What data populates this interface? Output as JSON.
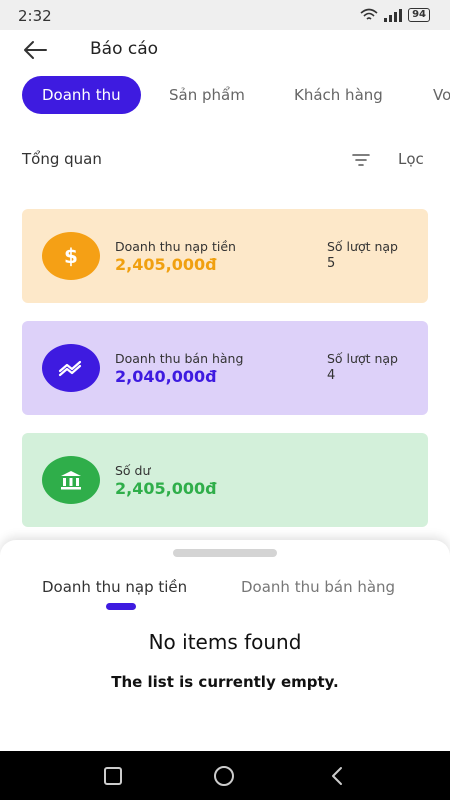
{
  "status": {
    "time": "2:32",
    "battery": "94"
  },
  "header": {
    "title": "Báo cáo"
  },
  "tabs": [
    {
      "label": "Doanh thu"
    },
    {
      "label": "Sản phẩm"
    },
    {
      "label": "Khách hàng"
    },
    {
      "label": "Vo"
    }
  ],
  "overview": {
    "title": "Tổng quan",
    "filter_label": "Lọc"
  },
  "cards": [
    {
      "label": "Doanh thu nạp tiền",
      "amount": "2,405,000đ",
      "count_label": "Số lượt nạp",
      "count": "5",
      "icon": "dollar-icon",
      "color": "#f5a015"
    },
    {
      "label": "Doanh thu bán hàng",
      "amount": "2,040,000đ",
      "count_label": "Số lượt nạp",
      "count": "4",
      "icon": "trending-icon",
      "color": "#3e1be0"
    },
    {
      "label": "Số dư",
      "amount": "2,405,000đ",
      "icon": "bank-icon",
      "color": "#2fae4a"
    }
  ],
  "sheet": {
    "tabs": [
      {
        "label": "Doanh thu nạp tiền"
      },
      {
        "label": "Doanh thu bán hàng"
      }
    ],
    "empty_title": "No items found",
    "empty_subtitle": "The list is currently empty."
  },
  "colors": {
    "accent": "#3e1be0",
    "orange": "#f5a015",
    "green": "#2fae4a"
  }
}
